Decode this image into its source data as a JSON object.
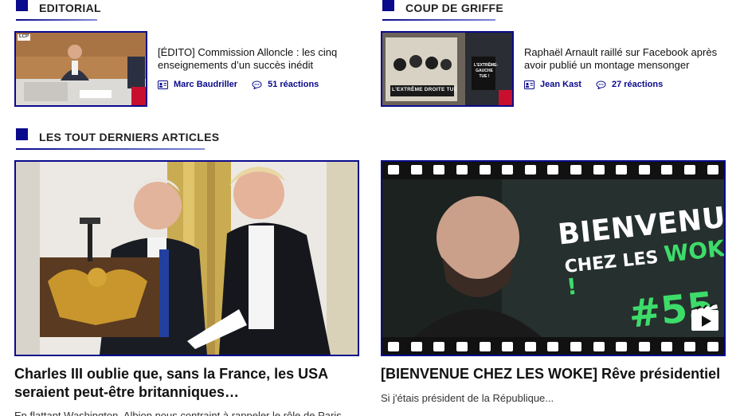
{
  "sections": {
    "editorial": "EDITORIAL",
    "coup_de_griffe": "COUP DE GRIFFE",
    "latest": "LES TOUT DERNIERS ARTICLES"
  },
  "editorial_article": {
    "headline": "[ÉDITO] Commission Alloncle : les cinq enseignements d’un succès inédit",
    "author": "Marc Baudriller",
    "reactions": "51 réactions",
    "thumb_badge": "LCP"
  },
  "griffe_article": {
    "headline": "Raphaël Arnault raillé sur Facebook après avoir publié un montage mensonger",
    "author": "Jean Kast",
    "reactions": "27 réactions",
    "poster_caption": "L'EXTRÊME DROITE TUE",
    "post_tag": "L'EXTRÊME-GAUCHE TUE !"
  },
  "latest_left": {
    "title": "Charles III oublie que, sans la France, les USA seraient peut-être britanniques…",
    "excerpt": "En flattant Washington, Albion nous contraint à rappeler le rôle de Paris"
  },
  "latest_right": {
    "title": "[BIENVENUE CHEZ LES WOKE] Rêve présidentiel",
    "excerpt": "Si j'étais président de la République...",
    "overlay_line1": "BIENVENUE",
    "overlay_line2_a": "CHEZ LES ",
    "overlay_line2_b": "WOKE !",
    "overlay_number": "#55"
  },
  "icons": {
    "author": "author-card-icon",
    "comments": "speech-bubble-icon",
    "video": "video-play-icon"
  },
  "colors": {
    "accent": "#0a0a8c",
    "green": "#3ddc6a"
  }
}
